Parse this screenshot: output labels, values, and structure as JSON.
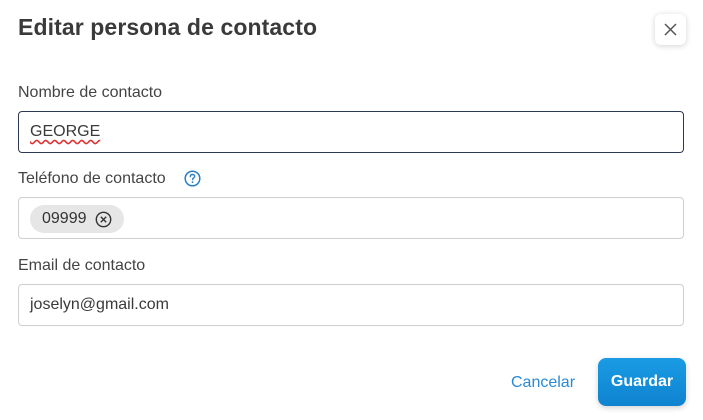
{
  "dialog": {
    "title": "Editar persona de contacto",
    "close_icon": "close-icon"
  },
  "form": {
    "name_label": "Nombre de contacto",
    "name_value": "GEORGE",
    "phone_label": "Teléfono de contacto",
    "phone_help_icon": "question-circle-icon",
    "phone_chips": [
      "09999"
    ],
    "email_label": "Email de contacto",
    "email_value": "joselyn@gmail.com"
  },
  "actions": {
    "cancel_label": "Cancelar",
    "save_label": "Guardar"
  },
  "colors": {
    "accent": "#1a9be4",
    "link": "#2a8ad3",
    "focus_border": "#2b3a52"
  }
}
